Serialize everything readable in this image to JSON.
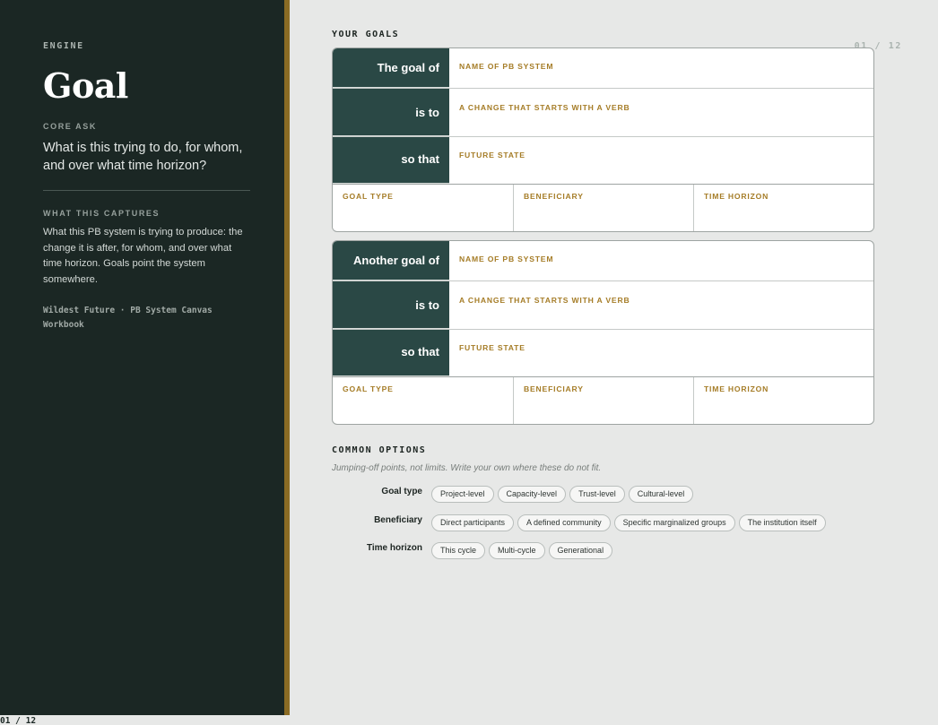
{
  "sidebar": {
    "section": "ENGINE",
    "page_count": "01 / 12",
    "title": "Goal",
    "core_ask_label": "CORE ASK",
    "core_ask_text": "What is this trying to do, for whom, and over what time horizon?",
    "captures_label": "WHAT THIS CAPTURES",
    "captures_text": "What this PB system is trying to produce: the change it is after, for whom, and over what time horizon. Goals point the system somewhere.",
    "credit": "Wildest Future · PB System Canvas Workbook"
  },
  "main": {
    "goals_heading": "YOUR GOALS",
    "goals": [
      {
        "label_1": "The goal of",
        "field_1": "NAME OF PB SYSTEM",
        "label_2": "is to",
        "field_2": "A CHANGE THAT STARTS WITH A VERB",
        "label_3": "so that",
        "field_3": "FUTURE STATE",
        "meta": [
          "GOAL TYPE",
          "BENEFICIARY",
          "TIME HORIZON"
        ]
      },
      {
        "label_1": "Another goal of",
        "field_1": "NAME OF PB SYSTEM",
        "label_2": "is to",
        "field_2": "A CHANGE THAT STARTS WITH A VERB",
        "label_3": "so that",
        "field_3": "FUTURE STATE",
        "meta": [
          "GOAL TYPE",
          "BENEFICIARY",
          "TIME HORIZON"
        ]
      }
    ],
    "options_heading": "COMMON OPTIONS",
    "options_sub": "Jumping-off points, not limits. Write your own where these do not fit.",
    "options": [
      {
        "label": "Goal type",
        "chips": [
          "Project-level",
          "Capacity-level",
          "Trust-level",
          "Cultural-level"
        ]
      },
      {
        "label": "Beneficiary",
        "chips": [
          "Direct participants",
          "A defined community",
          "Specific marginalized groups",
          "The institution itself"
        ]
      },
      {
        "label": "Time horizon",
        "chips": [
          "This cycle",
          "Multi-cycle",
          "Generational"
        ]
      }
    ]
  },
  "footer": {
    "page_num": "01 / 12"
  },
  "colors": {
    "sidebar_bg": "#1b2724",
    "accent_gold": "#8a6b24",
    "label_cell": "#2a4845",
    "field_label": "#a57c26"
  }
}
